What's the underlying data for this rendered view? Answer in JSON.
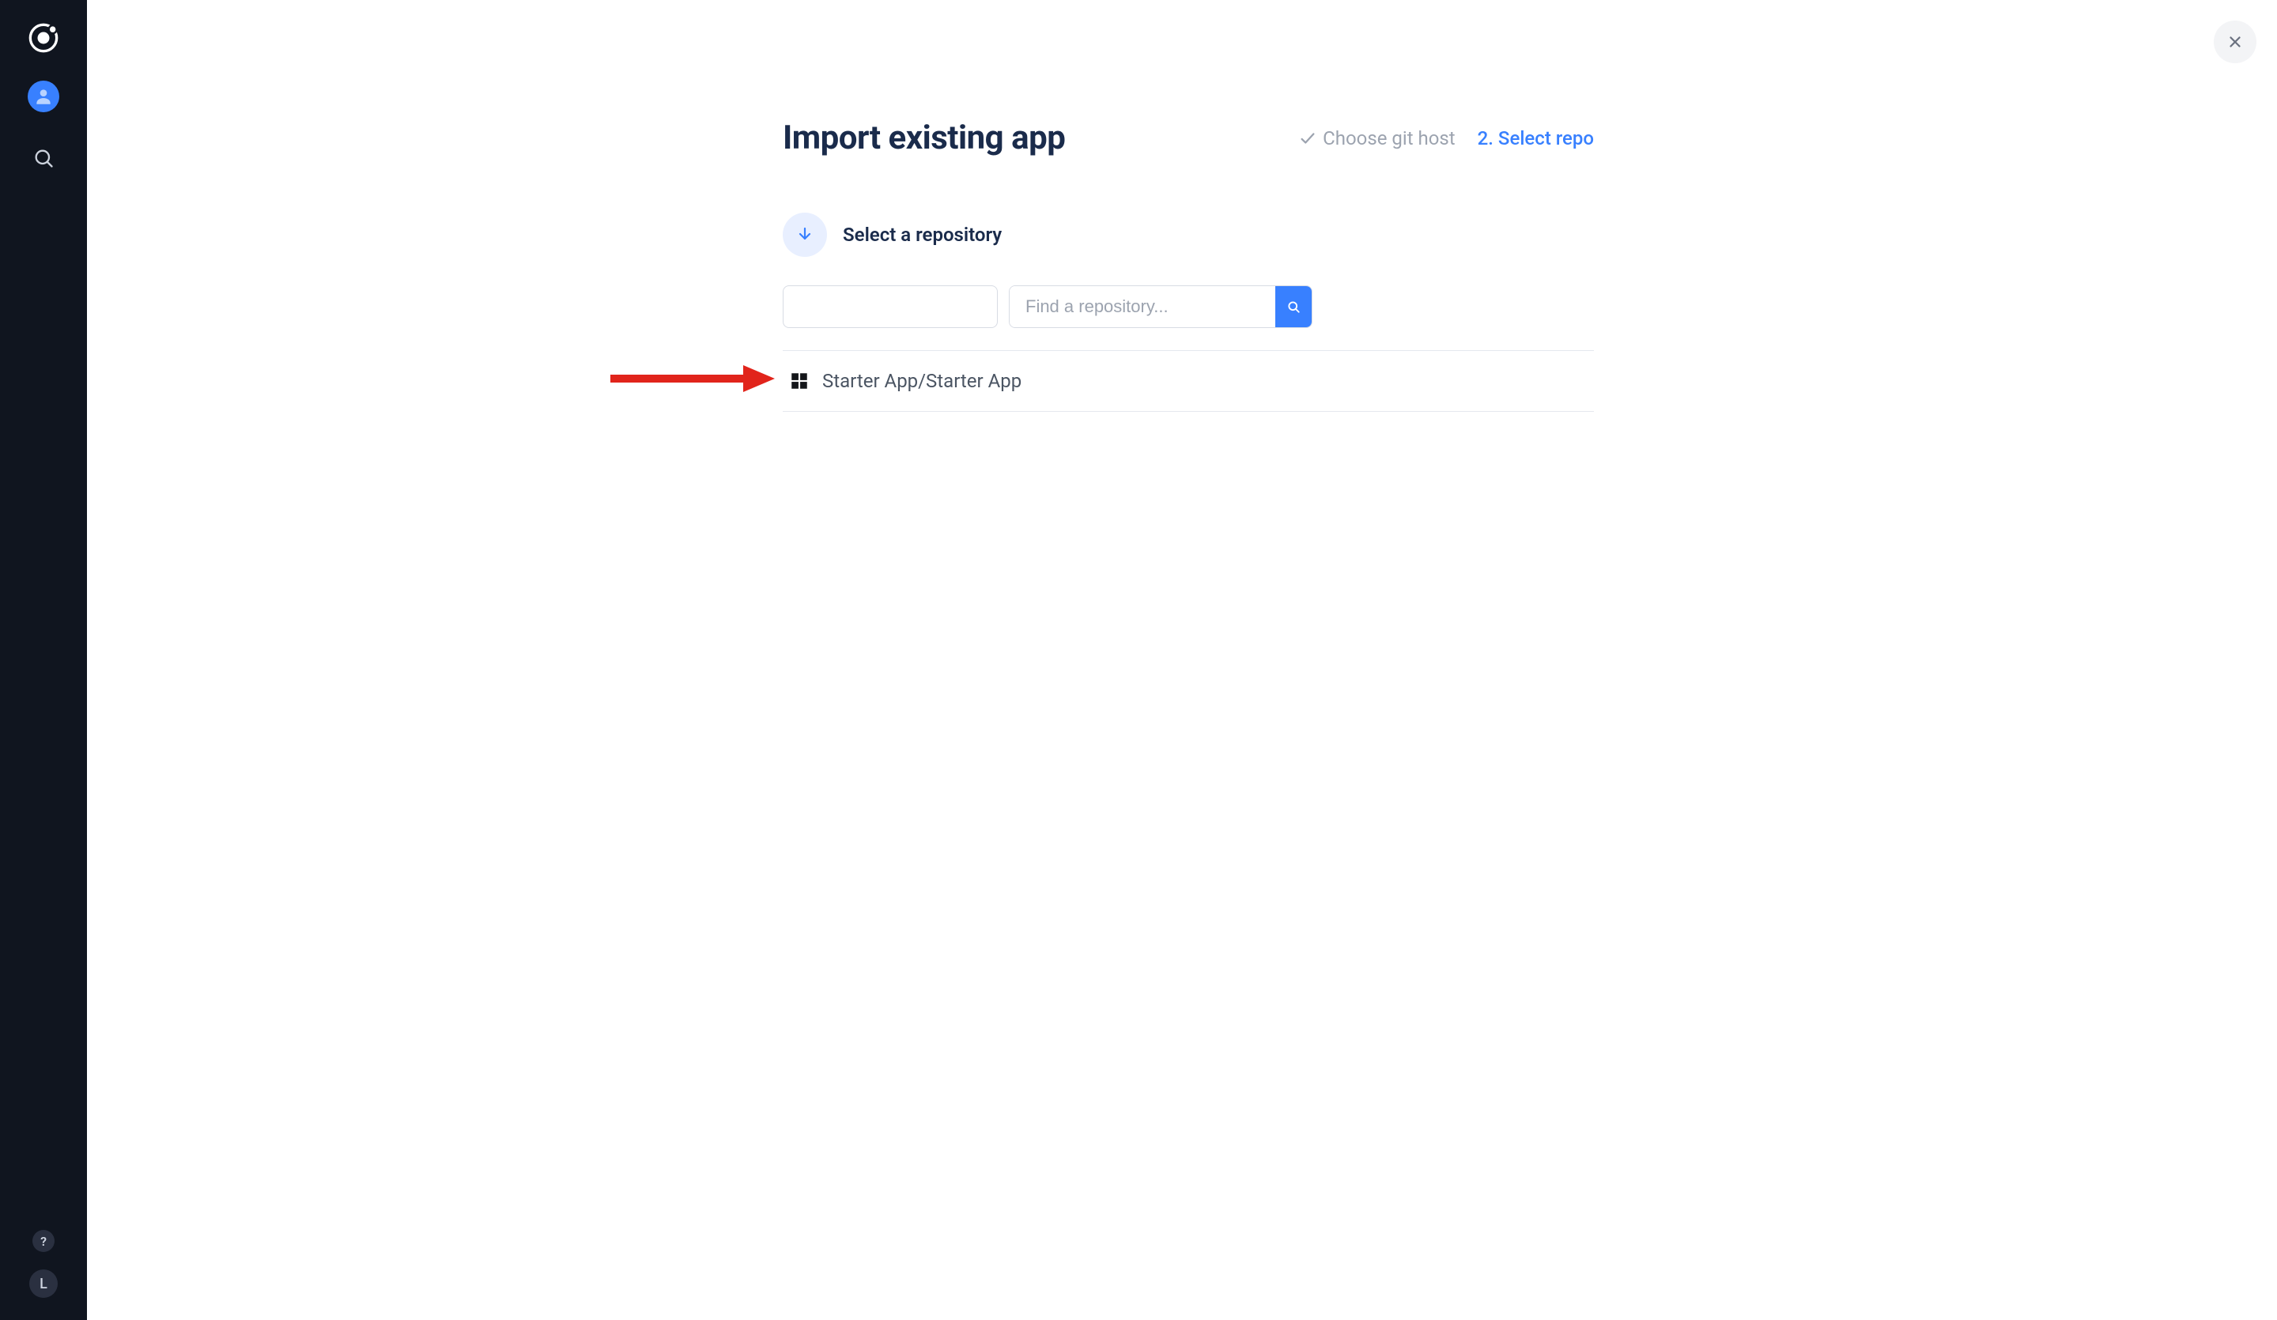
{
  "sidebar": {
    "help_glyph": "?",
    "user_initial": "L"
  },
  "page": {
    "title": "Import existing app",
    "steps": {
      "complete_label": "Choose git host",
      "active_label": "2. Select repo"
    },
    "section_label": "Select a repository",
    "search": {
      "placeholder": "Find a repository..."
    },
    "repos": [
      {
        "name": "Starter App/Starter App"
      }
    ]
  }
}
